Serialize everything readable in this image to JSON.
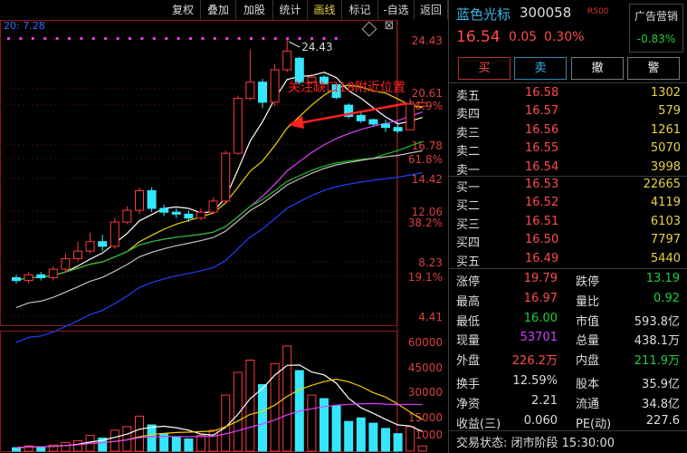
{
  "toolbar": {
    "buttons": [
      "复权",
      "叠加",
      "加股",
      "统计",
      "画线",
      "标记",
      "-自选",
      "返回"
    ],
    "active_index": 4,
    "period_label": "20: 7.28"
  },
  "chart_data": {
    "type": "candlestick",
    "y_labels": [
      "24.43",
      "20.61",
      "80.9%",
      "16.78",
      "61.8%",
      "14.42",
      "12.06",
      "38.2%",
      "8.23",
      "19.1%",
      "4.41"
    ],
    "vol_labels": [
      "60000",
      "45000",
      "30000",
      "15000",
      "X1000"
    ],
    "high_annotation": "24.43",
    "annotation_text": "关注缺口18附近位置",
    "candles": [
      {
        "o": 5.6,
        "c": 5.5,
        "h": 5.7,
        "l": 5.4
      },
      {
        "o": 5.5,
        "c": 5.7,
        "h": 5.8,
        "l": 5.4
      },
      {
        "o": 5.7,
        "c": 5.6,
        "h": 5.8,
        "l": 5.5
      },
      {
        "o": 5.6,
        "c": 5.9,
        "h": 6.0,
        "l": 5.5
      },
      {
        "o": 5.9,
        "c": 6.3,
        "h": 6.5,
        "l": 5.8
      },
      {
        "o": 6.3,
        "c": 6.6,
        "h": 7.0,
        "l": 6.2
      },
      {
        "o": 6.6,
        "c": 7.0,
        "h": 7.4,
        "l": 6.5
      },
      {
        "o": 7.0,
        "c": 6.8,
        "h": 7.3,
        "l": 6.6
      },
      {
        "o": 6.8,
        "c": 7.9,
        "h": 8.1,
        "l": 6.7
      },
      {
        "o": 7.9,
        "c": 8.5,
        "h": 8.7,
        "l": 7.8
      },
      {
        "o": 8.5,
        "c": 9.6,
        "h": 9.8,
        "l": 8.3
      },
      {
        "o": 9.6,
        "c": 8.6,
        "h": 9.8,
        "l": 8.4
      },
      {
        "o": 8.6,
        "c": 8.4,
        "h": 8.8,
        "l": 8.2
      },
      {
        "o": 8.4,
        "c": 8.3,
        "h": 8.6,
        "l": 8.1
      },
      {
        "o": 8.3,
        "c": 8.1,
        "h": 8.5,
        "l": 7.9
      },
      {
        "o": 8.1,
        "c": 8.4,
        "h": 8.6,
        "l": 8.0
      },
      {
        "o": 8.4,
        "c": 9.0,
        "h": 9.2,
        "l": 8.3
      },
      {
        "o": 9.0,
        "c": 12.1,
        "h": 12.3,
        "l": 8.9
      },
      {
        "o": 12.1,
        "c": 17.0,
        "h": 17.3,
        "l": 12.0
      },
      {
        "o": 17.0,
        "c": 18.8,
        "h": 23.0,
        "l": 16.8
      },
      {
        "o": 18.8,
        "c": 16.6,
        "h": 19.2,
        "l": 16.0
      },
      {
        "o": 16.6,
        "c": 20.3,
        "h": 21.0,
        "l": 16.2
      },
      {
        "o": 20.3,
        "c": 22.8,
        "h": 24.43,
        "l": 20.0
      },
      {
        "o": 21.8,
        "c": 18.8,
        "h": 22.0,
        "l": 18.5
      },
      {
        "o": 18.8,
        "c": 19.4,
        "h": 19.8,
        "l": 18.6
      },
      {
        "o": 19.4,
        "c": 18.6,
        "h": 19.6,
        "l": 18.2
      },
      {
        "o": 18.5,
        "c": 17.1,
        "h": 18.8,
        "l": 16.9
      },
      {
        "o": 16.3,
        "c": 15.2,
        "h": 16.5,
        "l": 15.0
      },
      {
        "o": 15.3,
        "c": 14.8,
        "h": 15.7,
        "l": 14.6
      },
      {
        "o": 14.9,
        "c": 14.5,
        "h": 15.0,
        "l": 14.3
      },
      {
        "o": 14.5,
        "c": 14.2,
        "h": 14.9,
        "l": 13.8
      },
      {
        "o": 14.2,
        "c": 13.9,
        "h": 14.7,
        "l": 13.7
      },
      {
        "o": 14.0,
        "c": 16.4,
        "h": 16.97,
        "l": 14.0
      },
      {
        "o": 16.2,
        "c": 16.54,
        "h": 16.97,
        "l": 16.0
      }
    ],
    "volumes": [
      2000,
      3000,
      2500,
      3500,
      5000,
      6000,
      9000,
      7500,
      12000,
      14000,
      20000,
      15000,
      10000,
      8000,
      7000,
      9000,
      12000,
      32000,
      45000,
      52000,
      38000,
      50000,
      60000,
      46000,
      32000,
      30000,
      26000,
      17000,
      19000,
      16000,
      13000,
      10000,
      14000,
      3000
    ],
    "up_color": "#ff3b3b",
    "down_color": "#34e6ff",
    "ma_colors": [
      "#ffffff",
      "#f0d000",
      "#e040ff",
      "#20c020",
      "#c0c0c0",
      "#2040ff"
    ]
  },
  "quote": {
    "name": "蓝色光标",
    "code": "300058",
    "r_mark": "R500",
    "sector_name": "广告营销",
    "sector_pct": "-0.83%",
    "price": "16.54",
    "change": "0.05",
    "change_pct": "0.30%",
    "buttons": {
      "buy": "买",
      "sell": "卖",
      "cancel": "撤",
      "alert": "警"
    },
    "asks": [
      {
        "label": "卖五",
        "price": "16.58",
        "vol": "1302"
      },
      {
        "label": "卖四",
        "price": "16.57",
        "vol": "579"
      },
      {
        "label": "卖三",
        "price": "16.56",
        "vol": "1261"
      },
      {
        "label": "卖二",
        "price": "16.55",
        "vol": "5070"
      },
      {
        "label": "卖一",
        "price": "16.54",
        "vol": "3998"
      }
    ],
    "bids": [
      {
        "label": "买一",
        "price": "16.53",
        "vol": "22665"
      },
      {
        "label": "买二",
        "price": "16.52",
        "vol": "4119"
      },
      {
        "label": "买三",
        "price": "16.51",
        "vol": "6103"
      },
      {
        "label": "买四",
        "price": "16.50",
        "vol": "7797"
      },
      {
        "label": "买五",
        "price": "16.49",
        "vol": "5440"
      }
    ],
    "stats": [
      {
        "k1": "涨停",
        "v1": "19.79",
        "c1": "#ff4b4b",
        "k2": "跌停",
        "v2": "13.19",
        "c2": "#1fce3a"
      },
      {
        "k1": "最高",
        "v1": "16.97",
        "c1": "#ff4b4b",
        "k2": "量比",
        "v2": "0.92",
        "c2": "#1fce3a"
      },
      {
        "k1": "最低",
        "v1": "16.00",
        "c1": "#1fce3a",
        "k2": "市值",
        "v2": "593.8亿",
        "c2": "#dddddd"
      },
      {
        "k1": "现量",
        "v1": "53701",
        "c1": "#d040ff",
        "k2": "总量",
        "v2": "438.1万",
        "c2": "#dddddd"
      },
      {
        "k1": "外盘",
        "v1": "226.2万",
        "c1": "#ff4b4b",
        "k2": "内盘",
        "v2": "211.9万",
        "c2": "#1fce3a"
      },
      {
        "k1": "换手",
        "v1": "12.59%",
        "c1": "#dddddd",
        "k2": "股本",
        "v2": "35.9亿",
        "c2": "#dddddd"
      },
      {
        "k1": "净资",
        "v1": "2.21",
        "c1": "#dddddd",
        "k2": "流通",
        "v2": "34.8亿",
        "c2": "#dddddd"
      },
      {
        "k1": "收益(三)",
        "v1": "0.060",
        "c1": "#dddddd",
        "k2": "PE(动)",
        "v2": "227.6",
        "c2": "#dddddd"
      }
    ],
    "status_label": "交易状态:",
    "status_value": "闭市阶段 15:30:00"
  }
}
